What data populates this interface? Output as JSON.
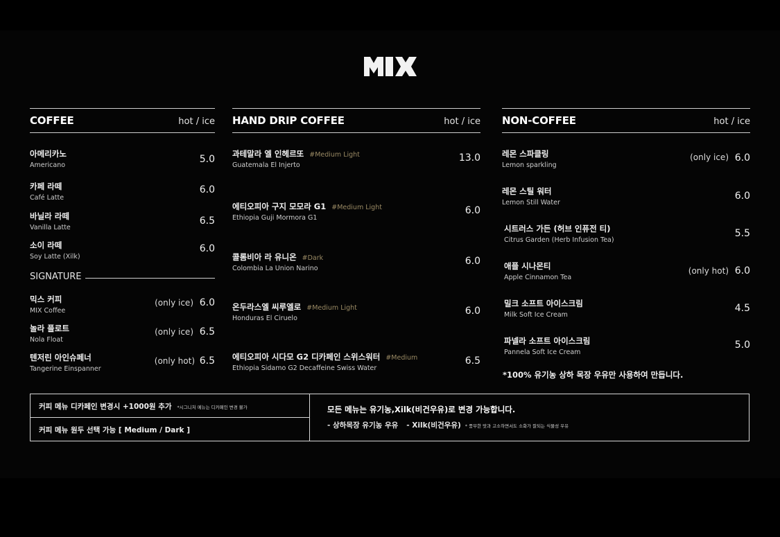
{
  "brand": {
    "logo_text": "MIX"
  },
  "coffee": {
    "title": "COFFEE",
    "temp": "hot / ice",
    "items": [
      {
        "ko": "아메리카노",
        "en": "Americano",
        "price": "5.0"
      },
      {
        "ko": "카페 라떼",
        "en": "Café Latte",
        "price": "6.0"
      },
      {
        "ko": "바닐라 라떼",
        "en": "Vanilla Latte",
        "price": "6.5"
      },
      {
        "ko": "소이 라떼",
        "en": "Soy Latte (Xilk)",
        "price": "6.0"
      }
    ],
    "signature_label": "SIGNATURE",
    "signature_items": [
      {
        "ko": "믹스 커피",
        "en": "MIX Coffee",
        "option": "(only ice)",
        "price": "6.0"
      },
      {
        "ko": "놀라 플로트",
        "en": "Nola Float",
        "option": "(only ice)",
        "price": "6.5"
      },
      {
        "ko": "텐저린 아인슈페너",
        "en": "Tangerine Einspanner",
        "option": "(only hot)",
        "price": "6.5"
      }
    ]
  },
  "hand_drip": {
    "title": "HAND DRIP COFFEE",
    "temp": "hot / ice",
    "items": [
      {
        "ko": "과테말라 엘 인헤르또",
        "note": "#Medium Light",
        "en": "Guatemala El Injerto",
        "price": "13.0"
      },
      {
        "ko": "에티오피아 구지 모모라 G1",
        "note": "#Medium Light",
        "en": "Ethiopia Guji Mormora  G1",
        "price": "6.0"
      },
      {
        "ko": "콜롬비아 라 유니온",
        "note": "#Dark",
        "en": "Colombia La Union Narino",
        "price": "6.0"
      },
      {
        "ko": "온두라스엘 씨루엘로",
        "note": "#Medium Light",
        "en": "Honduras El Ciruelo",
        "price": "6.0"
      },
      {
        "ko": "에티오피아 시다모 G2 디카페인 스위스워터",
        "note": "#Medium",
        "en": "Ethiopia Sidamo G2 Decaffeine Swiss Water",
        "price": "6.5"
      }
    ]
  },
  "non_coffee": {
    "title": "NON-COFFEE",
    "temp": "hot / ice",
    "items": [
      {
        "ko": "레몬 스파클링",
        "en": "Lemon sparkling",
        "option": "(only ice)",
        "price": "6.0"
      },
      {
        "ko": "레몬 스틸 워터",
        "en": "Lemon Still Water",
        "option": "",
        "price": "6.0"
      },
      {
        "ko": "시트러스 가든 (허브 인퓨전 티)",
        "en": "Citrus Garden (Herb Infusion Tea)",
        "option": "",
        "price": "5.5"
      },
      {
        "ko": "애플 시나몬티",
        "en": "Apple Cinnamon Tea",
        "option": "(only  hot)",
        "price": "6.0"
      },
      {
        "ko": "밀크 소프트 아이스크림",
        "en": "Milk Soft Ice Cream",
        "option": "",
        "price": "4.5"
      },
      {
        "ko": "파넬라 소프트 아이스크림",
        "en": "Pannela Soft Ice Cream",
        "option": "",
        "price": "5.0"
      }
    ],
    "footnote": "*100% 유기농 상하 목장 우유만 사용하여 만듭니다."
  },
  "info_box": {
    "left_row1": "커피 메뉴 디카페인 변경시 +1000원 추가",
    "left_row1_small": "*시그니처 메뉴는 디카페인 변경 불가",
    "left_row2": "커피 메뉴 원두 선택 가능 [ Medium / Dark ]",
    "right_title": "모든 메뉴는 유기농,Xilk(비건우유)로 변경 가능합니다.",
    "right_line_a": "- 상하목장 유기농 우유",
    "right_line_b": "- Xilk(비건우유)",
    "right_small": "* 풍부한 맛과 고소하면서도 소화가 잘되는 식물성 우유"
  }
}
